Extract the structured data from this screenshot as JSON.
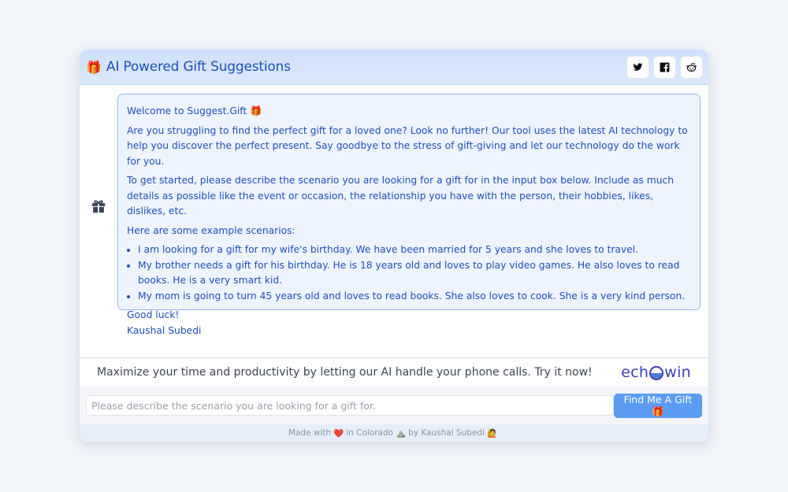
{
  "header": {
    "gift_emoji": "🎁",
    "title": "AI Powered Gift Suggestions",
    "social": [
      "twitter-icon",
      "facebook-icon",
      "reddit-icon"
    ]
  },
  "message": {
    "welcome": "Welcome to Suggest.Gift 🎁",
    "intro": "Are you struggling to find the perfect gift for a loved one? Look no further! Our tool uses the latest AI technology to help you discover the perfect present. Say goodbye to the stress of gift-giving and let our technology do the work for you.",
    "instructions": "To get started, please describe the scenario you are looking for a gift for in the input box below. Include as much details as possible like the event or occasion, the relationship you have with the person, their hobbies, likes, dislikes, etc.",
    "examples_heading": "Here are some example scenarios:",
    "examples": [
      "I am looking for a gift for my wife's birthday. We have been married for 5 years and she loves to travel.",
      "My brother needs a gift for his birthday. He is 18 years old and loves to play video games. He also loves to read books. He is a very smart kid.",
      "My mom is going to turn 45 years old and loves to read books. She also loves to cook. She is a very kind person."
    ],
    "closing": "Good luck!",
    "signature": "Kaushal Subedi"
  },
  "promo": {
    "text": "Maximize your time and productivity by letting our AI handle your phone calls. Try it now!",
    "brand_prefix": "ech",
    "brand_suffix": "win"
  },
  "input": {
    "placeholder": "Please describe the scenario you are looking for a gift for.",
    "button_label": "Find Me A Gift 🎁"
  },
  "footer": {
    "made_with": "Made with",
    "heart": "❤️",
    "location": "in Colorado",
    "mountain": "⛰️",
    "by": "by Kaushal Subedi",
    "person": "🙋"
  },
  "colors": {
    "accent": "#1f4fb7",
    "button": "#5b9cf2",
    "bubble_bg": "#eef4fe"
  }
}
